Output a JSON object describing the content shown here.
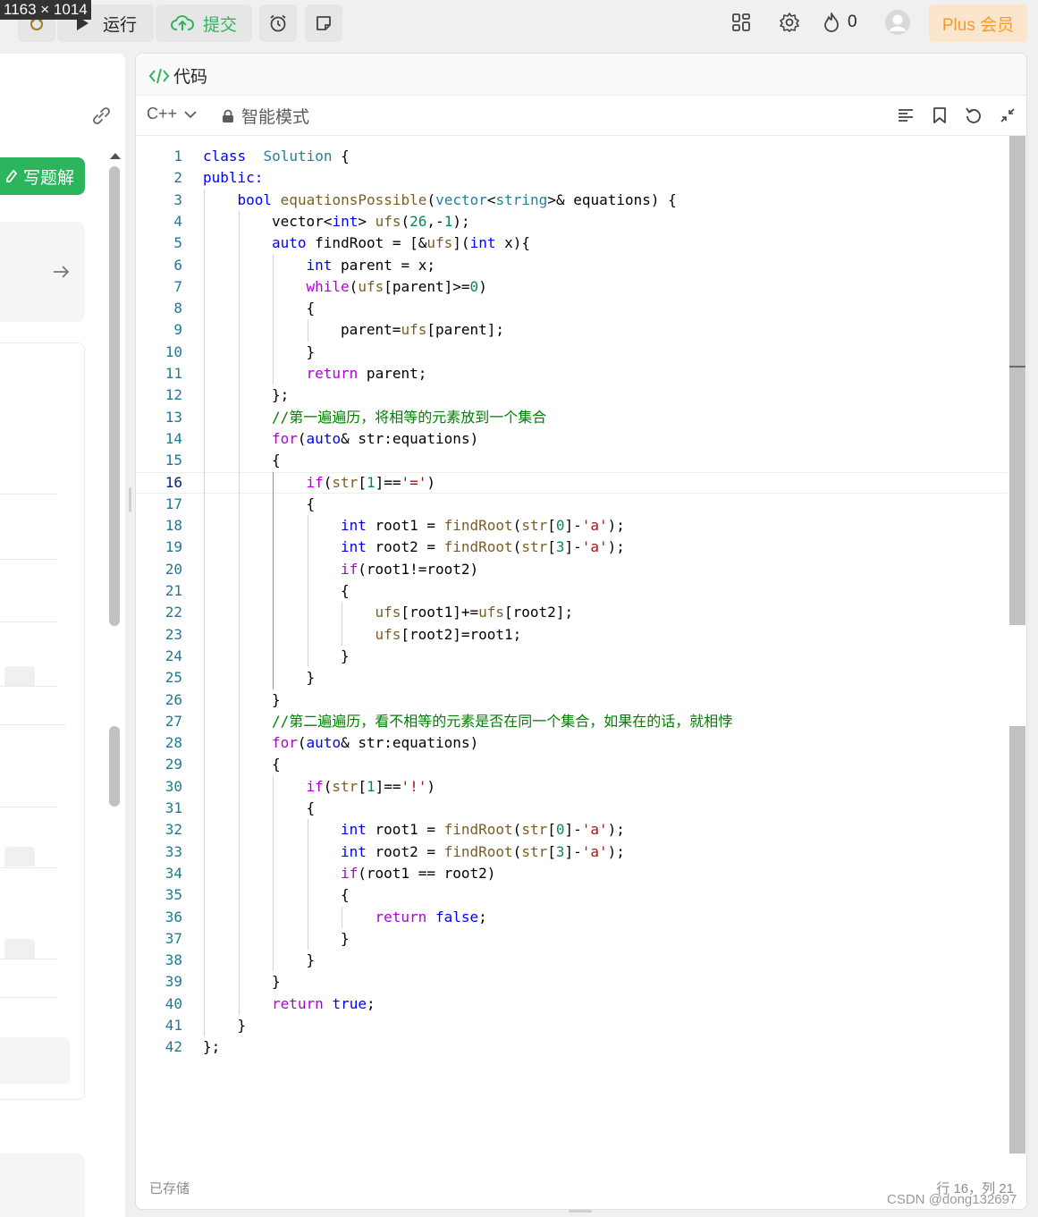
{
  "overlay": {
    "dimensions_text": "1163 × 1014"
  },
  "topbar": {
    "run_label": "运行",
    "submit_label": "提交",
    "streak_count": "0",
    "plus_label": "Plus 会员",
    "colors": {
      "submit_green": "#2db55d",
      "plus_orange": "#f39c29",
      "plus_bg": "#fbe5cc"
    }
  },
  "left_panel": {
    "write_solution_label": "写题解"
  },
  "code_panel": {
    "title": "代码",
    "language": "C++",
    "mode_label": "智能模式",
    "saved_status": "已存储",
    "cursor_position": "行 16，列 21"
  },
  "code": {
    "active_line": 16,
    "lines": [
      {
        "n": "1",
        "indent": 0,
        "tokens": [
          [
            "k",
            "class"
          ],
          [
            "",
            "  "
          ],
          [
            "t",
            "Solution"
          ],
          [
            "",
            " {"
          ]
        ]
      },
      {
        "n": "2",
        "indent": 0,
        "tokens": [
          [
            "k",
            "public:"
          ]
        ]
      },
      {
        "n": "3",
        "indent": 1,
        "tokens": [
          [
            "k",
            "bool"
          ],
          [
            "",
            " "
          ],
          [
            "f",
            "equationsPossible"
          ],
          [
            "",
            "("
          ],
          [
            "t",
            "vector"
          ],
          [
            "",
            "<"
          ],
          [
            "t",
            "string"
          ],
          [
            "",
            "&gt;& equations) {"
          ]
        ]
      },
      {
        "n": "4",
        "indent": 2,
        "tokens": [
          [
            "",
            "vector<"
          ],
          [
            "k",
            "int"
          ],
          [
            "",
            "> "
          ],
          [
            "f",
            "ufs"
          ],
          [
            "",
            "("
          ],
          [
            "n",
            "26"
          ],
          [
            "",
            ",-"
          ],
          [
            "n",
            "1"
          ],
          [
            "",
            ");"
          ]
        ]
      },
      {
        "n": "5",
        "indent": 2,
        "tokens": [
          [
            "k",
            "auto"
          ],
          [
            "",
            " findRoot = [&"
          ],
          [
            "f",
            "ufs"
          ],
          [
            "",
            "]("
          ],
          [
            "k",
            "int"
          ],
          [
            "",
            " x){"
          ]
        ]
      },
      {
        "n": "6",
        "indent": 3,
        "tokens": [
          [
            "k",
            "int"
          ],
          [
            "",
            " parent = x;"
          ]
        ]
      },
      {
        "n": "7",
        "indent": 3,
        "tokens": [
          [
            "p",
            "while"
          ],
          [
            "",
            "("
          ],
          [
            "f",
            "ufs"
          ],
          [
            "",
            "[parent]>="
          ],
          [
            "n",
            "0"
          ],
          [
            "",
            ")"
          ]
        ]
      },
      {
        "n": "8",
        "indent": 3,
        "tokens": [
          [
            "",
            "{"
          ]
        ]
      },
      {
        "n": "9",
        "indent": 4,
        "tokens": [
          [
            "",
            "parent="
          ],
          [
            "f",
            "ufs"
          ],
          [
            "",
            "[parent];"
          ]
        ]
      },
      {
        "n": "10",
        "indent": 3,
        "tokens": [
          [
            "",
            "}"
          ]
        ]
      },
      {
        "n": "11",
        "indent": 3,
        "tokens": [
          [
            "p",
            "return"
          ],
          [
            "",
            " parent;"
          ]
        ]
      },
      {
        "n": "12",
        "indent": 2,
        "tokens": [
          [
            "",
            "};"
          ]
        ]
      },
      {
        "n": "13",
        "indent": 2,
        "tokens": [
          [
            "c",
            "//第一遍遍历，将相等的元素放到一个集合"
          ]
        ]
      },
      {
        "n": "14",
        "indent": 2,
        "tokens": [
          [
            "p",
            "for"
          ],
          [
            "",
            "("
          ],
          [
            "k",
            "auto"
          ],
          [
            "",
            "& str:equations)"
          ]
        ]
      },
      {
        "n": "15",
        "indent": 2,
        "tokens": [
          [
            "",
            "{"
          ]
        ]
      },
      {
        "n": "16",
        "indent": 3,
        "tokens": [
          [
            "p",
            "if"
          ],
          [
            "",
            "("
          ],
          [
            "f",
            "str"
          ],
          [
            "",
            "["
          ],
          [
            "n",
            "1"
          ],
          [
            "",
            "]=="
          ],
          [
            "s",
            "'='"
          ],
          [
            "",
            ")"
          ]
        ]
      },
      {
        "n": "17",
        "indent": 3,
        "tokens": [
          [
            "",
            "{"
          ]
        ]
      },
      {
        "n": "18",
        "indent": 4,
        "tokens": [
          [
            "k",
            "int"
          ],
          [
            "",
            " root1 = "
          ],
          [
            "f",
            "findRoot"
          ],
          [
            "",
            "("
          ],
          [
            "f",
            "str"
          ],
          [
            "",
            "["
          ],
          [
            "n",
            "0"
          ],
          [
            "",
            "]-"
          ],
          [
            "s",
            "'a'"
          ],
          [
            "",
            ");"
          ]
        ]
      },
      {
        "n": "19",
        "indent": 4,
        "tokens": [
          [
            "k",
            "int"
          ],
          [
            "",
            " root2 = "
          ],
          [
            "f",
            "findRoot"
          ],
          [
            "",
            "("
          ],
          [
            "f",
            "str"
          ],
          [
            "",
            "["
          ],
          [
            "n",
            "3"
          ],
          [
            "",
            "]-"
          ],
          [
            "s",
            "'a'"
          ],
          [
            "",
            ");"
          ]
        ]
      },
      {
        "n": "20",
        "indent": 4,
        "tokens": [
          [
            "p",
            "if"
          ],
          [
            "",
            "(root1!=root2)"
          ]
        ]
      },
      {
        "n": "21",
        "indent": 4,
        "tokens": [
          [
            "",
            "{"
          ]
        ]
      },
      {
        "n": "22",
        "indent": 5,
        "tokens": [
          [
            "f",
            "ufs"
          ],
          [
            "",
            "[root1]+="
          ],
          [
            "f",
            "ufs"
          ],
          [
            "",
            "[root2];"
          ]
        ]
      },
      {
        "n": "23",
        "indent": 5,
        "tokens": [
          [
            "f",
            "ufs"
          ],
          [
            "",
            "[root2]=root1;"
          ]
        ]
      },
      {
        "n": "24",
        "indent": 4,
        "tokens": [
          [
            "",
            "}"
          ]
        ]
      },
      {
        "n": "25",
        "indent": 3,
        "tokens": [
          [
            "",
            "}"
          ]
        ]
      },
      {
        "n": "26",
        "indent": 2,
        "tokens": [
          [
            "",
            "}"
          ]
        ]
      },
      {
        "n": "27",
        "indent": 2,
        "tokens": [
          [
            "c",
            "//第二遍遍历，看不相等的元素是否在同一个集合，如果在的话，就相悖"
          ]
        ]
      },
      {
        "n": "28",
        "indent": 2,
        "tokens": [
          [
            "p",
            "for"
          ],
          [
            "",
            "("
          ],
          [
            "k",
            "auto"
          ],
          [
            "",
            "& str:equations)"
          ]
        ]
      },
      {
        "n": "29",
        "indent": 2,
        "tokens": [
          [
            "",
            "{"
          ]
        ]
      },
      {
        "n": "30",
        "indent": 3,
        "tokens": [
          [
            "p",
            "if"
          ],
          [
            "",
            "("
          ],
          [
            "f",
            "str"
          ],
          [
            "",
            "["
          ],
          [
            "n",
            "1"
          ],
          [
            "",
            "]=="
          ],
          [
            "s",
            "'!'"
          ],
          [
            "",
            ")"
          ]
        ]
      },
      {
        "n": "31",
        "indent": 3,
        "tokens": [
          [
            "",
            "{"
          ]
        ]
      },
      {
        "n": "32",
        "indent": 4,
        "tokens": [
          [
            "k",
            "int"
          ],
          [
            "",
            " root1 = "
          ],
          [
            "f",
            "findRoot"
          ],
          [
            "",
            "("
          ],
          [
            "f",
            "str"
          ],
          [
            "",
            "["
          ],
          [
            "n",
            "0"
          ],
          [
            "",
            "]-"
          ],
          [
            "s",
            "'a'"
          ],
          [
            "",
            ");"
          ]
        ]
      },
      {
        "n": "33",
        "indent": 4,
        "tokens": [
          [
            "k",
            "int"
          ],
          [
            "",
            " root2 = "
          ],
          [
            "f",
            "findRoot"
          ],
          [
            "",
            "("
          ],
          [
            "f",
            "str"
          ],
          [
            "",
            "["
          ],
          [
            "n",
            "3"
          ],
          [
            "",
            "]-"
          ],
          [
            "s",
            "'a'"
          ],
          [
            "",
            ");"
          ]
        ]
      },
      {
        "n": "34",
        "indent": 4,
        "tokens": [
          [
            "p",
            "if"
          ],
          [
            "",
            "(root1 == root2)"
          ]
        ]
      },
      {
        "n": "35",
        "indent": 4,
        "tokens": [
          [
            "",
            "{"
          ]
        ]
      },
      {
        "n": "36",
        "indent": 5,
        "tokens": [
          [
            "p",
            "return"
          ],
          [
            "",
            " "
          ],
          [
            "k",
            "false"
          ],
          [
            "",
            ";"
          ]
        ]
      },
      {
        "n": "37",
        "indent": 4,
        "tokens": [
          [
            "",
            "}"
          ]
        ]
      },
      {
        "n": "38",
        "indent": 3,
        "tokens": [
          [
            "",
            "}"
          ]
        ]
      },
      {
        "n": "39",
        "indent": 2,
        "tokens": [
          [
            "",
            "}"
          ]
        ]
      },
      {
        "n": "40",
        "indent": 2,
        "tokens": [
          [
            "p",
            "return"
          ],
          [
            "",
            " "
          ],
          [
            "k",
            "true"
          ],
          [
            "",
            ";"
          ]
        ]
      },
      {
        "n": "41",
        "indent": 1,
        "tokens": [
          [
            "",
            "}"
          ]
        ]
      },
      {
        "n": "42",
        "indent": 0,
        "tokens": [
          [
            "",
            "};"
          ]
        ]
      }
    ]
  },
  "watermark": "CSDN @dong132697"
}
